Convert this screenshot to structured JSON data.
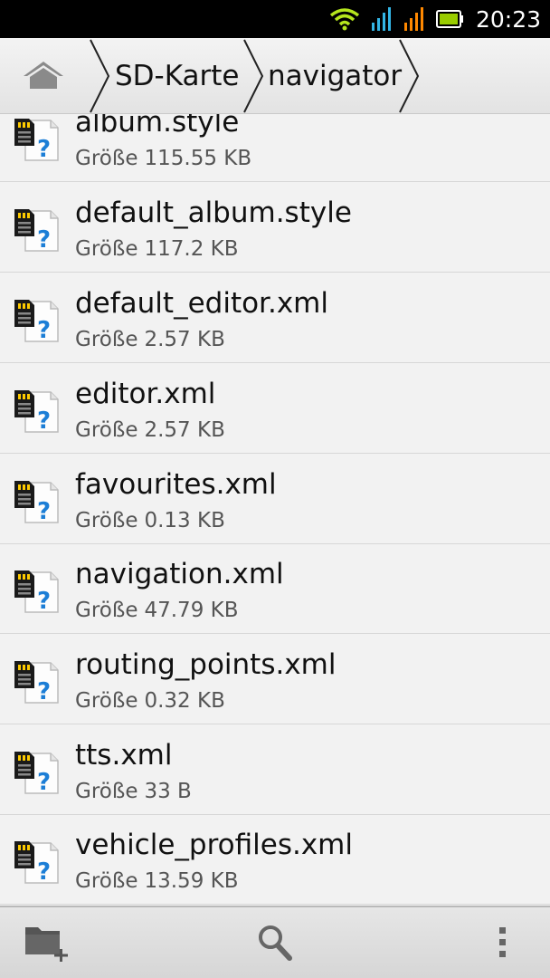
{
  "status_bar": {
    "time": "20:23",
    "icons": [
      "wifi-icon",
      "signal-icon",
      "signal-icon",
      "battery-icon"
    ],
    "colors": {
      "wifi": "#b5e61d",
      "signal_1": "#33b5e5",
      "signal_2": "#ff8800",
      "battery": "#99cc00"
    }
  },
  "breadcrumb": {
    "home_icon": "home-icon",
    "items": [
      "SD-Karte",
      "navigator"
    ]
  },
  "files": [
    {
      "name": "album.style",
      "size_label": "Größe",
      "size": "115.55 KB"
    },
    {
      "name": "default_album.style",
      "size_label": "Größe",
      "size": "117.2 KB"
    },
    {
      "name": "default_editor.xml",
      "size_label": "Größe",
      "size": "2.57 KB"
    },
    {
      "name": "editor.xml",
      "size_label": "Größe",
      "size": "2.57 KB"
    },
    {
      "name": "favourites.xml",
      "size_label": "Größe",
      "size": "0.13 KB"
    },
    {
      "name": "navigation.xml",
      "size_label": "Größe",
      "size": "47.79 KB"
    },
    {
      "name": "routing_points.xml",
      "size_label": "Größe",
      "size": "0.32 KB"
    },
    {
      "name": "tts.xml",
      "size_label": "Größe",
      "size": "33 B"
    },
    {
      "name": "vehicle_profiles.xml",
      "size_label": "Größe",
      "size": "13.59 KB"
    }
  ],
  "bottom_bar": {
    "icons": [
      "new-folder-icon",
      "search-icon",
      "overflow-menu-icon"
    ]
  }
}
